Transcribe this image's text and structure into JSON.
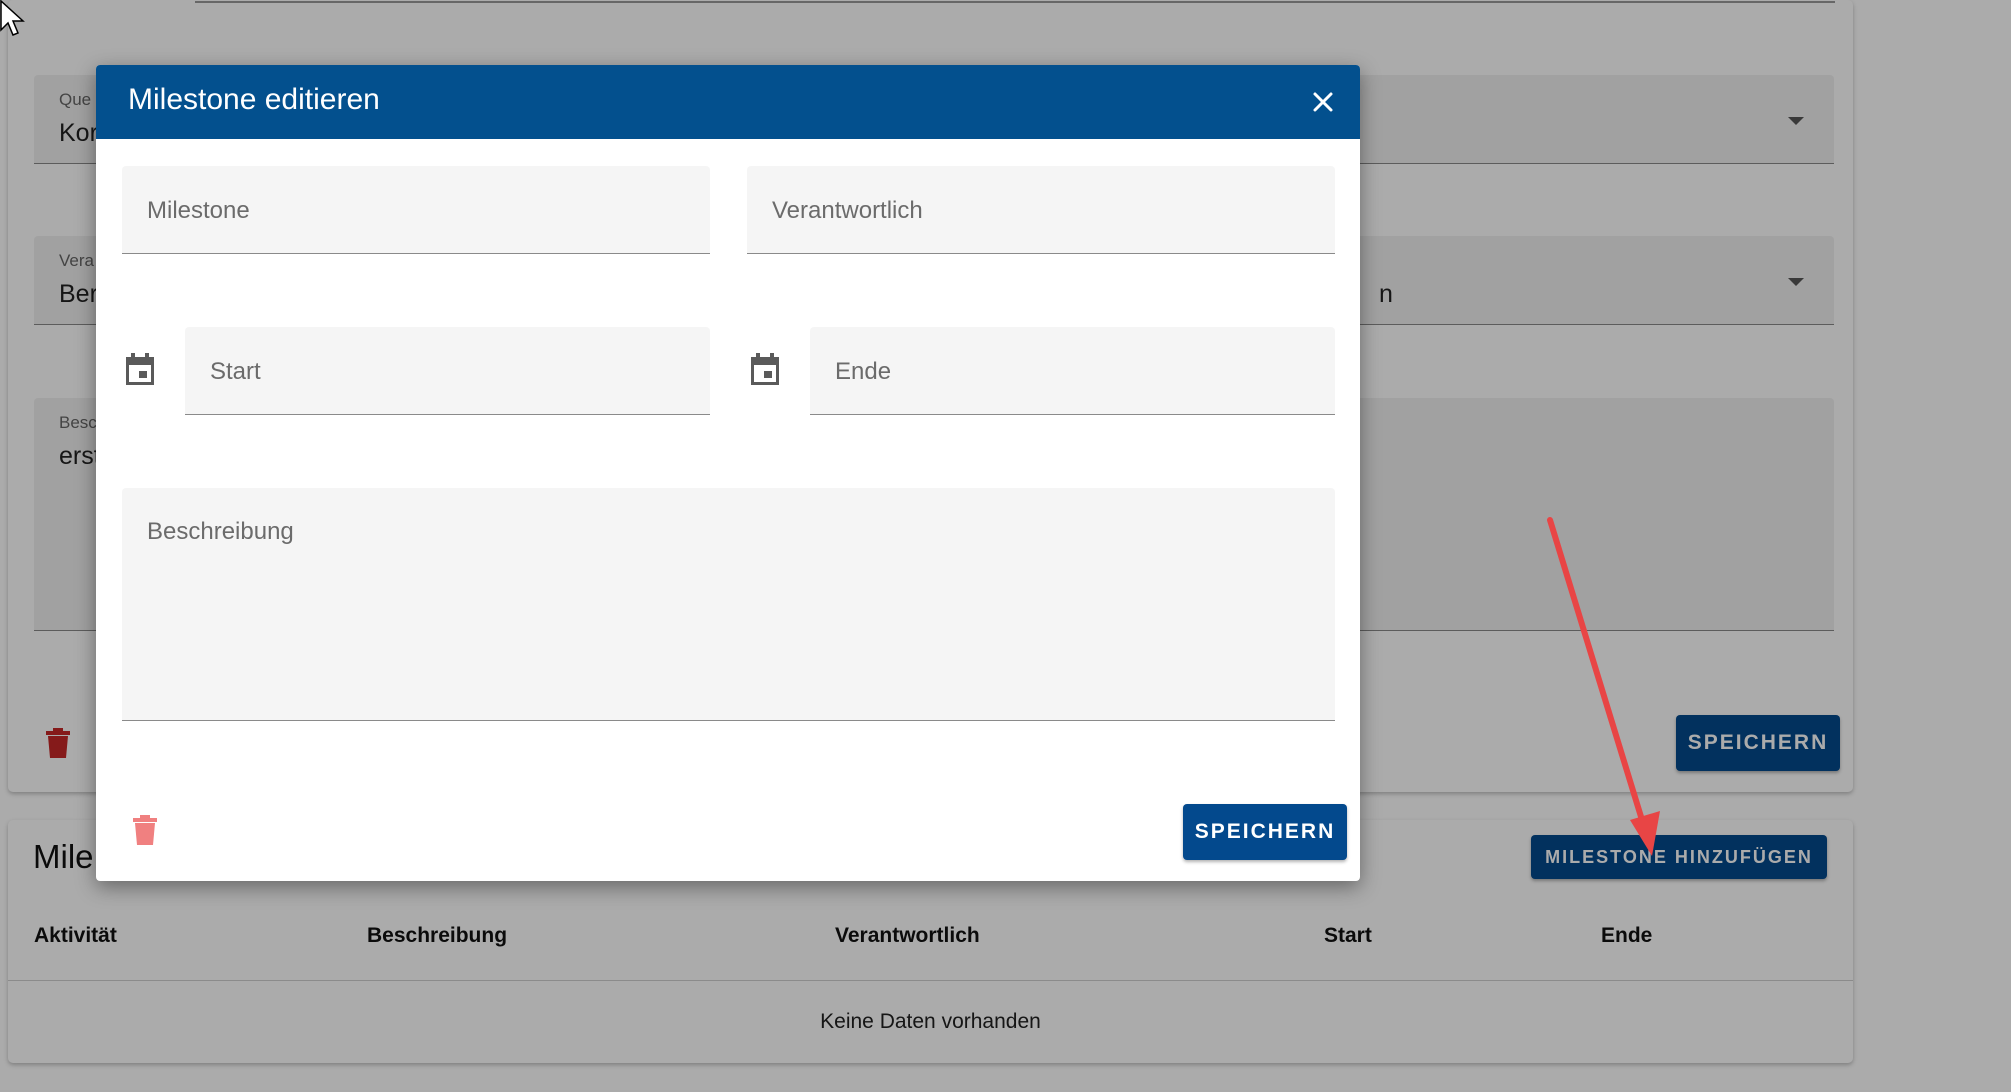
{
  "background": {
    "fields": [
      {
        "label": "Que",
        "value": "Kor",
        "type": "select"
      },
      {
        "label": "Vera",
        "value": "Ber",
        "type": "select",
        "right_fragment": "n"
      },
      {
        "label": "Besc",
        "value": "erst",
        "type": "textarea"
      }
    ],
    "save_label": "SPEICHERN",
    "milestones": {
      "title": "Mile",
      "add_button": "MILESTONE HINZUFÜGEN",
      "columns": [
        "Aktivität",
        "Beschreibung",
        "Verantwortlich",
        "Start",
        "Ende"
      ],
      "empty_text": "Keine Daten vorhanden"
    }
  },
  "dialog": {
    "title": "Milestone editieren",
    "fields": {
      "milestone": {
        "placeholder": "Milestone",
        "value": ""
      },
      "responsible": {
        "placeholder": "Verantwortlich",
        "value": ""
      },
      "start": {
        "placeholder": "Start",
        "value": ""
      },
      "end": {
        "placeholder": "Ende",
        "value": ""
      },
      "description": {
        "placeholder": "Beschreibung",
        "value": ""
      }
    },
    "save_label": "SPEICHERN",
    "icons": {
      "close": "close-icon",
      "calendar": "calendar-icon",
      "delete": "trash-icon"
    }
  },
  "colors": {
    "primary": "#03508e",
    "button": "#03498d",
    "delete_icon": "#f08080",
    "annotation_arrow": "#e84545"
  }
}
